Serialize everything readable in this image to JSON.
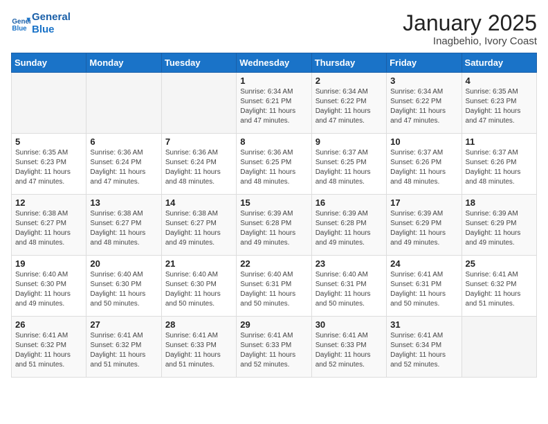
{
  "header": {
    "logo_line1": "General",
    "logo_line2": "Blue",
    "month": "January 2025",
    "location": "Inagbehio, Ivory Coast"
  },
  "weekdays": [
    "Sunday",
    "Monday",
    "Tuesday",
    "Wednesday",
    "Thursday",
    "Friday",
    "Saturday"
  ],
  "weeks": [
    [
      {
        "day": "",
        "info": ""
      },
      {
        "day": "",
        "info": ""
      },
      {
        "day": "",
        "info": ""
      },
      {
        "day": "1",
        "info": "Sunrise: 6:34 AM\nSunset: 6:21 PM\nDaylight: 11 hours\nand 47 minutes."
      },
      {
        "day": "2",
        "info": "Sunrise: 6:34 AM\nSunset: 6:22 PM\nDaylight: 11 hours\nand 47 minutes."
      },
      {
        "day": "3",
        "info": "Sunrise: 6:34 AM\nSunset: 6:22 PM\nDaylight: 11 hours\nand 47 minutes."
      },
      {
        "day": "4",
        "info": "Sunrise: 6:35 AM\nSunset: 6:23 PM\nDaylight: 11 hours\nand 47 minutes."
      }
    ],
    [
      {
        "day": "5",
        "info": "Sunrise: 6:35 AM\nSunset: 6:23 PM\nDaylight: 11 hours\nand 47 minutes."
      },
      {
        "day": "6",
        "info": "Sunrise: 6:36 AM\nSunset: 6:24 PM\nDaylight: 11 hours\nand 47 minutes."
      },
      {
        "day": "7",
        "info": "Sunrise: 6:36 AM\nSunset: 6:24 PM\nDaylight: 11 hours\nand 48 minutes."
      },
      {
        "day": "8",
        "info": "Sunrise: 6:36 AM\nSunset: 6:25 PM\nDaylight: 11 hours\nand 48 minutes."
      },
      {
        "day": "9",
        "info": "Sunrise: 6:37 AM\nSunset: 6:25 PM\nDaylight: 11 hours\nand 48 minutes."
      },
      {
        "day": "10",
        "info": "Sunrise: 6:37 AM\nSunset: 6:26 PM\nDaylight: 11 hours\nand 48 minutes."
      },
      {
        "day": "11",
        "info": "Sunrise: 6:37 AM\nSunset: 6:26 PM\nDaylight: 11 hours\nand 48 minutes."
      }
    ],
    [
      {
        "day": "12",
        "info": "Sunrise: 6:38 AM\nSunset: 6:27 PM\nDaylight: 11 hours\nand 48 minutes."
      },
      {
        "day": "13",
        "info": "Sunrise: 6:38 AM\nSunset: 6:27 PM\nDaylight: 11 hours\nand 48 minutes."
      },
      {
        "day": "14",
        "info": "Sunrise: 6:38 AM\nSunset: 6:27 PM\nDaylight: 11 hours\nand 49 minutes."
      },
      {
        "day": "15",
        "info": "Sunrise: 6:39 AM\nSunset: 6:28 PM\nDaylight: 11 hours\nand 49 minutes."
      },
      {
        "day": "16",
        "info": "Sunrise: 6:39 AM\nSunset: 6:28 PM\nDaylight: 11 hours\nand 49 minutes."
      },
      {
        "day": "17",
        "info": "Sunrise: 6:39 AM\nSunset: 6:29 PM\nDaylight: 11 hours\nand 49 minutes."
      },
      {
        "day": "18",
        "info": "Sunrise: 6:39 AM\nSunset: 6:29 PM\nDaylight: 11 hours\nand 49 minutes."
      }
    ],
    [
      {
        "day": "19",
        "info": "Sunrise: 6:40 AM\nSunset: 6:30 PM\nDaylight: 11 hours\nand 49 minutes."
      },
      {
        "day": "20",
        "info": "Sunrise: 6:40 AM\nSunset: 6:30 PM\nDaylight: 11 hours\nand 50 minutes."
      },
      {
        "day": "21",
        "info": "Sunrise: 6:40 AM\nSunset: 6:30 PM\nDaylight: 11 hours\nand 50 minutes."
      },
      {
        "day": "22",
        "info": "Sunrise: 6:40 AM\nSunset: 6:31 PM\nDaylight: 11 hours\nand 50 minutes."
      },
      {
        "day": "23",
        "info": "Sunrise: 6:40 AM\nSunset: 6:31 PM\nDaylight: 11 hours\nand 50 minutes."
      },
      {
        "day": "24",
        "info": "Sunrise: 6:41 AM\nSunset: 6:31 PM\nDaylight: 11 hours\nand 50 minutes."
      },
      {
        "day": "25",
        "info": "Sunrise: 6:41 AM\nSunset: 6:32 PM\nDaylight: 11 hours\nand 51 minutes."
      }
    ],
    [
      {
        "day": "26",
        "info": "Sunrise: 6:41 AM\nSunset: 6:32 PM\nDaylight: 11 hours\nand 51 minutes."
      },
      {
        "day": "27",
        "info": "Sunrise: 6:41 AM\nSunset: 6:32 PM\nDaylight: 11 hours\nand 51 minutes."
      },
      {
        "day": "28",
        "info": "Sunrise: 6:41 AM\nSunset: 6:33 PM\nDaylight: 11 hours\nand 51 minutes."
      },
      {
        "day": "29",
        "info": "Sunrise: 6:41 AM\nSunset: 6:33 PM\nDaylight: 11 hours\nand 52 minutes."
      },
      {
        "day": "30",
        "info": "Sunrise: 6:41 AM\nSunset: 6:33 PM\nDaylight: 11 hours\nand 52 minutes."
      },
      {
        "day": "31",
        "info": "Sunrise: 6:41 AM\nSunset: 6:34 PM\nDaylight: 11 hours\nand 52 minutes."
      },
      {
        "day": "",
        "info": ""
      }
    ]
  ]
}
